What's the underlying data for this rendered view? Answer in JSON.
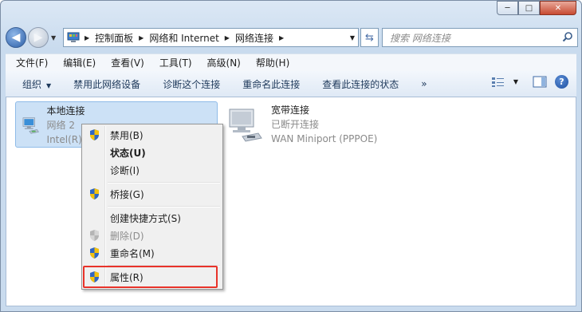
{
  "window": {
    "buttons": {
      "minimize": "─",
      "maximize": "□",
      "close": "✕"
    }
  },
  "address_bar": {
    "crumbs": [
      "控制面板",
      "网络和 Internet",
      "网络连接"
    ]
  },
  "search": {
    "placeholder": "搜索 网络连接"
  },
  "menu": [
    "文件(F)",
    "编辑(E)",
    "查看(V)",
    "工具(T)",
    "高级(N)",
    "帮助(H)"
  ],
  "commands": {
    "organize": "组织",
    "disable": "禁用此网络设备",
    "diagnose": "诊断这个连接",
    "rename": "重命名此连接",
    "status": "查看此连接的状态",
    "more": "»"
  },
  "connections": [
    {
      "name": "本地连接",
      "line1": "网络 2",
      "line2": "Intel(R) 82574L Gigabit Network Co"
    },
    {
      "name": "宽带连接",
      "line1": "已断开连接",
      "line2": "WAN Miniport (PPPOE)"
    }
  ],
  "context_menu": {
    "disable": "禁用(B)",
    "status": "状态(U)",
    "diagnose": "诊断(I)",
    "bridge": "桥接(G)",
    "shortcut": "创建快捷方式(S)",
    "delete": "删除(D)",
    "rename": "重命名(M)",
    "properties": "属性(R)"
  },
  "colors": {
    "highlight_box": "#e8332a",
    "selection": "#cce1f6"
  }
}
